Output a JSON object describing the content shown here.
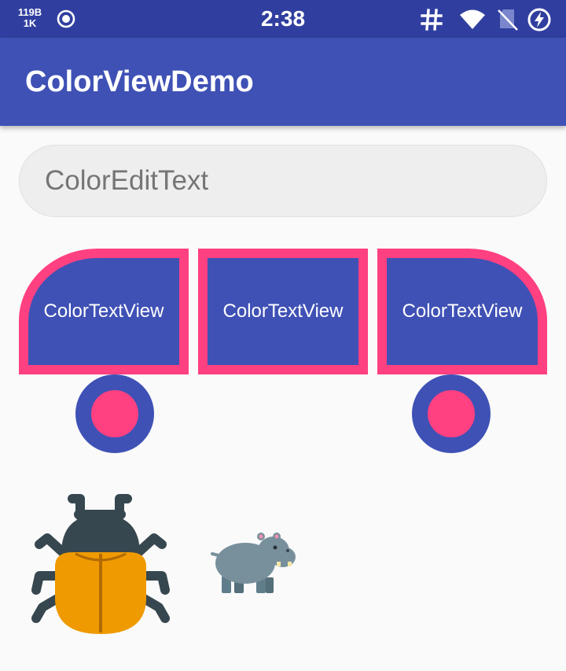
{
  "status_bar": {
    "net_speed_value": "119B",
    "net_speed_unit": "1K",
    "time": "2:38",
    "icons": [
      "record-icon",
      "hashtag-icon",
      "wifi-icon",
      "no-sim-icon",
      "battery-saver-icon"
    ],
    "background": "#303f9f"
  },
  "app_bar": {
    "title": "ColorViewDemo",
    "background": "#3f51b5"
  },
  "edit_text": {
    "placeholder": "ColorEditText"
  },
  "text_views": {
    "left_label": "ColorTextView",
    "middle_label": "ColorTextView",
    "right_label": "ColorTextView"
  },
  "images": {
    "beetle": "beetle-image",
    "hippo": "hippo-image"
  },
  "colors": {
    "primary": "#3f51b5",
    "primary_dark": "#303f9f",
    "accent": "#ff4081",
    "background": "#fafafa"
  }
}
